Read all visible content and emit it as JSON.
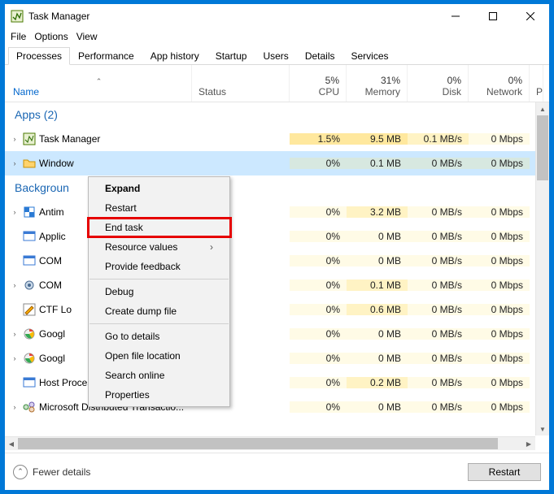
{
  "window": {
    "title": "Task Manager"
  },
  "menu": {
    "file": "File",
    "options": "Options",
    "view": "View"
  },
  "tabs": {
    "processes": "Processes",
    "performance": "Performance",
    "app_history": "App history",
    "startup": "Startup",
    "users": "Users",
    "details": "Details",
    "services": "Services"
  },
  "columns": {
    "name": "Name",
    "status": "Status",
    "cpu": {
      "value": "5%",
      "label": "CPU"
    },
    "memory": {
      "value": "31%",
      "label": "Memory"
    },
    "disk": {
      "value": "0%",
      "label": "Disk"
    },
    "network": {
      "value": "0%",
      "label": "Network"
    },
    "extra": "P"
  },
  "groups": {
    "apps": "Apps (2)",
    "background": "Backgroun"
  },
  "rows": {
    "r0": {
      "name": "Task Manager",
      "cpu": "1.5%",
      "mem": "9.5 MB",
      "disk": "0.1 MB/s",
      "net": "0 Mbps"
    },
    "r1": {
      "name": "Window",
      "cpu": "0%",
      "mem": "0.1 MB",
      "disk": "0 MB/s",
      "net": "0 Mbps"
    },
    "r2": {
      "name": "Antim",
      "cpu": "0%",
      "mem": "3.2 MB",
      "disk": "0 MB/s",
      "net": "0 Mbps"
    },
    "r3": {
      "name": "Applic",
      "cpu": "0%",
      "mem": "0 MB",
      "disk": "0 MB/s",
      "net": "0 Mbps"
    },
    "r4": {
      "name": "COM",
      "cpu": "0%",
      "mem": "0 MB",
      "disk": "0 MB/s",
      "net": "0 Mbps"
    },
    "r5": {
      "name": "COM",
      "cpu": "0%",
      "mem": "0.1 MB",
      "disk": "0 MB/s",
      "net": "0 Mbps"
    },
    "r6": {
      "name": "CTF Lo",
      "cpu": "0%",
      "mem": "0.6 MB",
      "disk": "0 MB/s",
      "net": "0 Mbps"
    },
    "r7": {
      "name": "Googl",
      "cpu": "0%",
      "mem": "0 MB",
      "disk": "0 MB/s",
      "net": "0 Mbps"
    },
    "r8": {
      "name": "Googl",
      "cpu": "0%",
      "mem": "0 MB",
      "disk": "0 MB/s",
      "net": "0 Mbps"
    },
    "r9": {
      "name": "Host Process for Windows Tasks",
      "cpu": "0%",
      "mem": "0.2 MB",
      "disk": "0 MB/s",
      "net": "0 Mbps"
    },
    "r10": {
      "name": "Microsoft Distributed Transactio...",
      "cpu": "0%",
      "mem": "0 MB",
      "disk": "0 MB/s",
      "net": "0 Mbps"
    }
  },
  "context_menu": {
    "expand": "Expand",
    "restart": "Restart",
    "end_task": "End task",
    "resource_values": "Resource values",
    "provide_feedback": "Provide feedback",
    "debug": "Debug",
    "create_dump": "Create dump file",
    "go_to_details": "Go to details",
    "open_file_location": "Open file location",
    "search_online": "Search online",
    "properties": "Properties"
  },
  "footer": {
    "fewer": "Fewer details",
    "restart": "Restart"
  }
}
